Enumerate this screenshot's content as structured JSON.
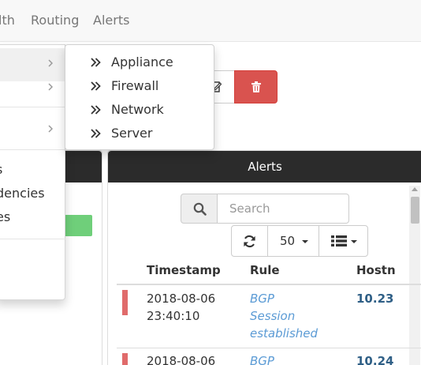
{
  "navbar": {
    "items": [
      {
        "label": "lth"
      },
      {
        "label": "Routing"
      },
      {
        "label": "Alerts"
      }
    ]
  },
  "menu": {
    "visible_items": [
      {
        "label": "s"
      },
      {
        "label": "dencies"
      },
      {
        "label": "es"
      }
    ],
    "submenu": [
      {
        "label": "Appliance",
        "icon": "double-chevron-right-icon"
      },
      {
        "label": "Firewall",
        "icon": "double-chevron-right-icon"
      },
      {
        "label": "Network",
        "icon": "double-chevron-right-icon"
      },
      {
        "label": "Server",
        "icon": "double-chevron-right-icon"
      }
    ]
  },
  "actions": {
    "edit_icon": "pencil-icon",
    "delete_icon": "trash-icon",
    "delete_color": "#d9534f"
  },
  "alerts": {
    "title": "Alerts",
    "search_placeholder": "Search",
    "page_size": "50",
    "columns": [
      "Timestamp",
      "Rule",
      "Hostn"
    ],
    "rows": [
      {
        "date": "2018-08-06",
        "time": "23:40:10",
        "rule_lines": [
          "BGP",
          "Session",
          "established"
        ],
        "host": "10.23"
      },
      {
        "date": "2018-08-06",
        "time": "",
        "rule_lines": [
          "BGP"
        ],
        "host": "10.24"
      }
    ],
    "severity_color": "#e06b6b",
    "header_color": "#2b2b2b"
  }
}
